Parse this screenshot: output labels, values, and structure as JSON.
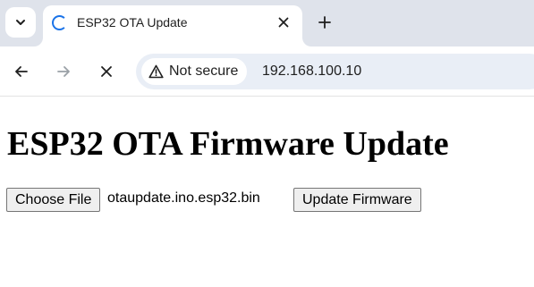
{
  "browser": {
    "tab": {
      "title": "ESP32 OTA Update"
    },
    "toolbar": {
      "security_label": "Not secure",
      "url": "192.168.100.10"
    },
    "icons": {
      "tab_search": "chevron-down-icon",
      "loading": "loading-spinner-icon",
      "close_tab": "close-icon",
      "new_tab": "plus-icon",
      "back": "arrow-left-icon",
      "forward": "arrow-right-icon",
      "stop": "close-icon",
      "security": "warning-triangle-icon"
    }
  },
  "page": {
    "heading": "ESP32 OTA Firmware Update",
    "file_input": {
      "button_label": "Choose File",
      "selected_file": "otaupdate.ino.esp32.bin"
    },
    "submit_label": "Update Firmware"
  },
  "colors": {
    "tabstrip_bg": "#dfe3eb",
    "omnibox_bg": "#e9eef6",
    "spinner": "#1a73e8"
  }
}
